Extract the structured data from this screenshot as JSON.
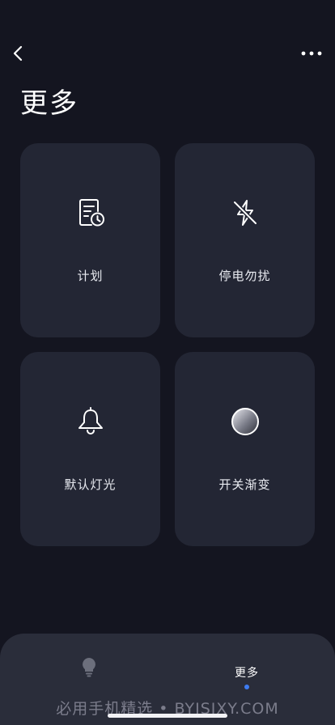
{
  "header": {
    "back_icon": "chevron-left-icon",
    "menu_icon": "more-horizontal-icon",
    "title": "更多"
  },
  "cards": [
    {
      "label": "计划",
      "icon": "schedule-document-clock-icon"
    },
    {
      "label": "停电勿扰",
      "icon": "flash-off-icon"
    },
    {
      "label": "默认灯光",
      "icon": "bell-icon"
    },
    {
      "label": "开关渐变",
      "icon": "gradient-circle-icon"
    }
  ],
  "tabbar": {
    "tabs": [
      {
        "label": "",
        "icon": "lightbulb-icon",
        "active": false
      },
      {
        "label": "更多",
        "active": true
      }
    ],
    "active_color": "#3e7cf2"
  },
  "watermark": "必用手机精选 • BYJSJXY.COM",
  "colors": {
    "background": "#141520",
    "card": "#232634",
    "tabbar": "#2a2d3a"
  }
}
